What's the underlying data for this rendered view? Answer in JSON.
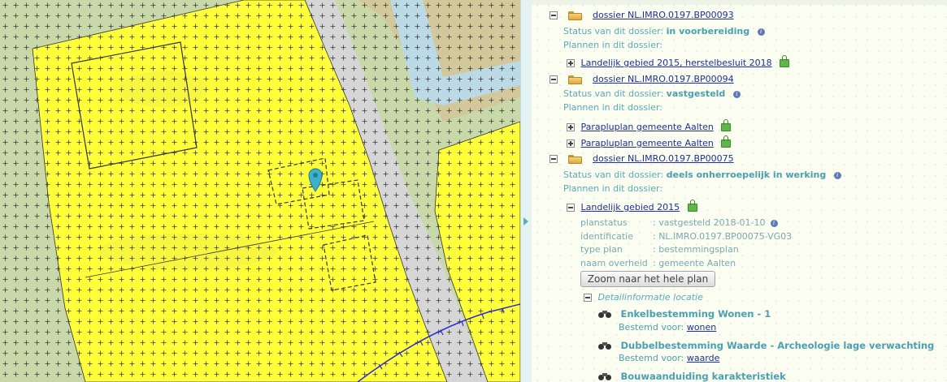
{
  "panel": {
    "dossiers": [
      {
        "id": "dossier NL.IMRO.0197.BP00093",
        "status_label": "Status van dit dossier:",
        "status": "in voorbereiding",
        "plans_label": "Plannen in dit dossier:",
        "plans": [
          "Landelijk gebied 2015, herstelbesluit 2018"
        ]
      },
      {
        "id": "dossier NL.IMRO.0197.BP00094",
        "status_label": "Status van dit dossier:",
        "status": "vastgesteld",
        "plans_label": "Plannen in dit dossier:",
        "plans": [
          "Parapluplan gemeente Aalten",
          "Parapluplan gemeente Aalten"
        ]
      },
      {
        "id": "dossier NL.IMRO.0197.BP00075",
        "status_label": "Status van dit dossier:",
        "status": "deels onherroepelijk in werking",
        "plans_label": "Plannen in dit dossier:",
        "plan": {
          "name": "Landelijk gebied 2015",
          "fields": [
            {
              "key": "planstatus",
              "value": ": vastgesteld 2018-01-10"
            },
            {
              "key": "identificatie",
              "value": ": NL.IMRO.0197.BP00075-VG03"
            },
            {
              "key": "type plan",
              "value": ": bestemmingsplan"
            },
            {
              "key": "naam overheid",
              "value": ": gemeente Aalten"
            }
          ],
          "zoom_button": "Zoom naar het hele plan",
          "detail_label": "Detailinformatie locatie",
          "details": [
            {
              "title": "Enkelbestemming Wonen - 1",
              "sub_label": "Bestemd voor:",
              "sub_link": "wonen"
            },
            {
              "title": "Dubbelbestemming Waarde - Archeologie lage verwachting",
              "sub_label": "Bestemd voor:",
              "sub_link": "waarde"
            },
            {
              "title": "Bouwaanduiding karakteristiek",
              "sub_label": "",
              "sub_link": ""
            }
          ]
        }
      }
    ],
    "icons": {
      "collapse": "minus-toggle-icon",
      "expand": "plus-toggle-icon",
      "folder": "folder-icon",
      "info": "info-icon",
      "lock": "lock-icon",
      "binoculars": "binoculars-icon",
      "map_marker": "map-marker-icon"
    }
  },
  "colors": {
    "zone_yellow": "#ffff3a",
    "zone_green": "#c9d8a9",
    "road_gray": "#d7d7d7",
    "water_blue": "#bcd9e6",
    "marker": "#3fb0c9",
    "link": "#1f2f9a"
  }
}
